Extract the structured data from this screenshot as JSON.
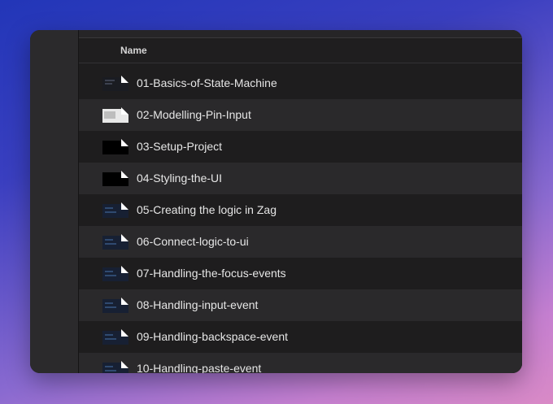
{
  "window": {
    "column_header": "Name"
  },
  "files": [
    {
      "name": "01-Basics-of-State-Machine",
      "thumb": "dark-doc"
    },
    {
      "name": "02-Modelling-Pin-Input",
      "thumb": "light-doc"
    },
    {
      "name": "03-Setup-Project",
      "thumb": "black-doc"
    },
    {
      "name": "04-Styling-the-UI",
      "thumb": "black-doc"
    },
    {
      "name": "05-Creating the logic in Zag",
      "thumb": "navy-doc"
    },
    {
      "name": "06-Connect-logic-to-ui",
      "thumb": "navy-doc"
    },
    {
      "name": "07-Handling-the-focus-events",
      "thumb": "navy-doc"
    },
    {
      "name": "08-Handling-input-event",
      "thumb": "navy-doc"
    },
    {
      "name": "09-Handling-backspace-event",
      "thumb": "navy-doc"
    },
    {
      "name": "10-Handling-paste-event",
      "thumb": "navy-doc"
    }
  ],
  "colors": {
    "window_bg": "#1f1e1f",
    "row_alt_bg": "#2a292b",
    "text": "#e6e6e6"
  }
}
